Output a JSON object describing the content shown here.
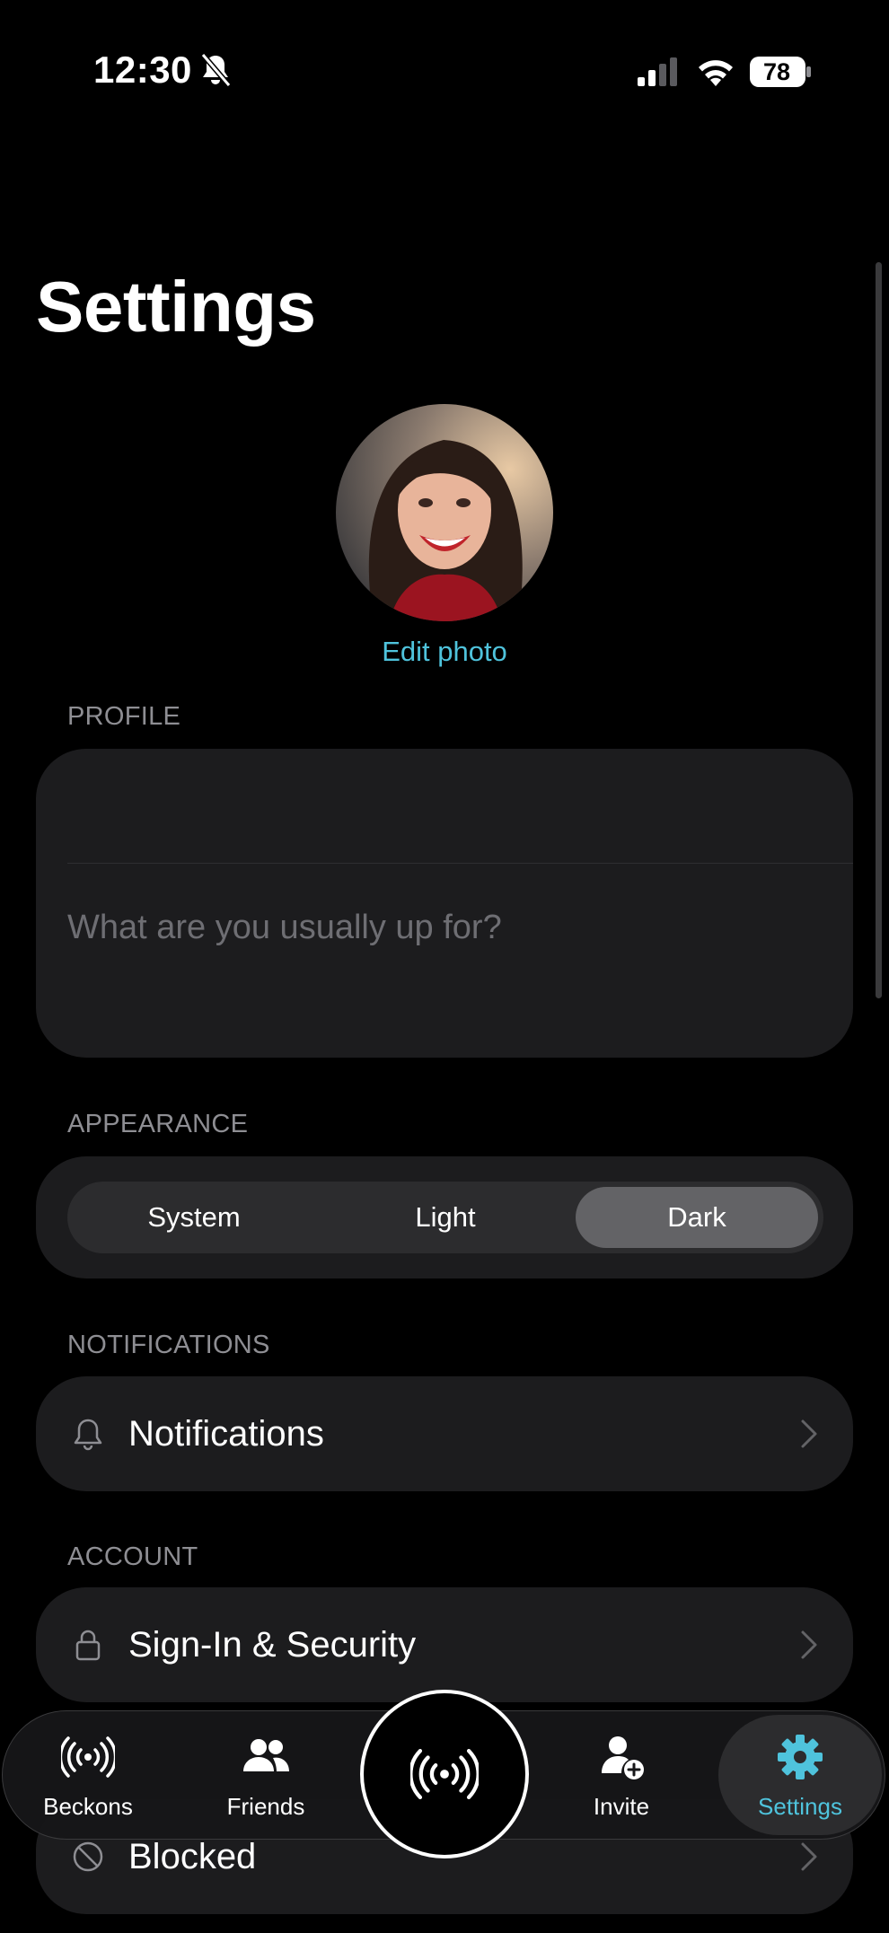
{
  "status_bar": {
    "time": "12:30",
    "battery": "78",
    "icons": [
      "bell-slash-icon",
      "cellular-signal-icon",
      "wifi-icon",
      "battery-icon"
    ]
  },
  "page": {
    "title": "Settings"
  },
  "avatar": {
    "edit_label": "Edit photo"
  },
  "profile": {
    "section_label": "PROFILE",
    "name_value": "",
    "bio_placeholder": "What are you usually up for?"
  },
  "appearance": {
    "section_label": "APPEARANCE",
    "options": [
      "System",
      "Light",
      "Dark"
    ],
    "selected": "Dark"
  },
  "notifications": {
    "section_label": "NOTIFICATIONS",
    "row_label": "Notifications",
    "icon": "bell-icon"
  },
  "account": {
    "section_label": "ACCOUNT",
    "rows": [
      {
        "label": "Sign-In & Security",
        "icon": "lock-icon"
      },
      {
        "label": "Blocked",
        "icon": "prohibited-icon"
      }
    ]
  },
  "tab_bar": {
    "tabs": [
      {
        "label": "Beckons",
        "icon": "broadcast-icon"
      },
      {
        "label": "Friends",
        "icon": "people-icon"
      },
      {
        "label": "",
        "icon": "broadcast-center-icon"
      },
      {
        "label": "Invite",
        "icon": "person-add-icon"
      },
      {
        "label": "Settings",
        "icon": "gear-icon"
      }
    ],
    "active": "Settings"
  },
  "colors": {
    "accent": "#4fc3dc",
    "background": "#000000",
    "card": "#1c1c1e",
    "secondary_text": "#8e8e93",
    "segment_active": "#636366"
  }
}
